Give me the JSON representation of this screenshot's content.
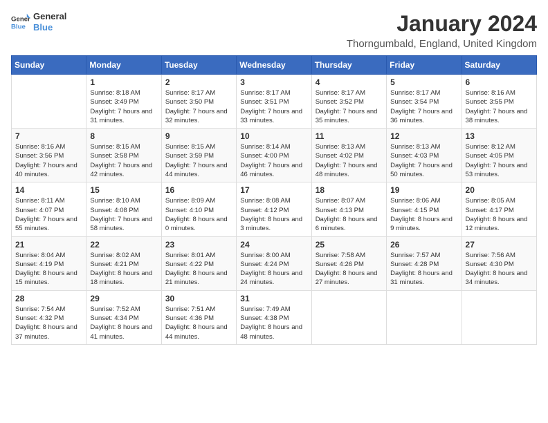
{
  "logo": {
    "line1": "General",
    "line2": "Blue"
  },
  "title": "January 2024",
  "location": "Thorngumbald, England, United Kingdom",
  "days_of_week": [
    "Sunday",
    "Monday",
    "Tuesday",
    "Wednesday",
    "Thursday",
    "Friday",
    "Saturday"
  ],
  "weeks": [
    [
      {
        "day": "",
        "sunrise": "",
        "sunset": "",
        "daylight": ""
      },
      {
        "day": "1",
        "sunrise": "Sunrise: 8:18 AM",
        "sunset": "Sunset: 3:49 PM",
        "daylight": "Daylight: 7 hours and 31 minutes."
      },
      {
        "day": "2",
        "sunrise": "Sunrise: 8:17 AM",
        "sunset": "Sunset: 3:50 PM",
        "daylight": "Daylight: 7 hours and 32 minutes."
      },
      {
        "day": "3",
        "sunrise": "Sunrise: 8:17 AM",
        "sunset": "Sunset: 3:51 PM",
        "daylight": "Daylight: 7 hours and 33 minutes."
      },
      {
        "day": "4",
        "sunrise": "Sunrise: 8:17 AM",
        "sunset": "Sunset: 3:52 PM",
        "daylight": "Daylight: 7 hours and 35 minutes."
      },
      {
        "day": "5",
        "sunrise": "Sunrise: 8:17 AM",
        "sunset": "Sunset: 3:54 PM",
        "daylight": "Daylight: 7 hours and 36 minutes."
      },
      {
        "day": "6",
        "sunrise": "Sunrise: 8:16 AM",
        "sunset": "Sunset: 3:55 PM",
        "daylight": "Daylight: 7 hours and 38 minutes."
      }
    ],
    [
      {
        "day": "7",
        "sunrise": "Sunrise: 8:16 AM",
        "sunset": "Sunset: 3:56 PM",
        "daylight": "Daylight: 7 hours and 40 minutes."
      },
      {
        "day": "8",
        "sunrise": "Sunrise: 8:15 AM",
        "sunset": "Sunset: 3:58 PM",
        "daylight": "Daylight: 7 hours and 42 minutes."
      },
      {
        "day": "9",
        "sunrise": "Sunrise: 8:15 AM",
        "sunset": "Sunset: 3:59 PM",
        "daylight": "Daylight: 7 hours and 44 minutes."
      },
      {
        "day": "10",
        "sunrise": "Sunrise: 8:14 AM",
        "sunset": "Sunset: 4:00 PM",
        "daylight": "Daylight: 7 hours and 46 minutes."
      },
      {
        "day": "11",
        "sunrise": "Sunrise: 8:13 AM",
        "sunset": "Sunset: 4:02 PM",
        "daylight": "Daylight: 7 hours and 48 minutes."
      },
      {
        "day": "12",
        "sunrise": "Sunrise: 8:13 AM",
        "sunset": "Sunset: 4:03 PM",
        "daylight": "Daylight: 7 hours and 50 minutes."
      },
      {
        "day": "13",
        "sunrise": "Sunrise: 8:12 AM",
        "sunset": "Sunset: 4:05 PM",
        "daylight": "Daylight: 7 hours and 53 minutes."
      }
    ],
    [
      {
        "day": "14",
        "sunrise": "Sunrise: 8:11 AM",
        "sunset": "Sunset: 4:07 PM",
        "daylight": "Daylight: 7 hours and 55 minutes."
      },
      {
        "day": "15",
        "sunrise": "Sunrise: 8:10 AM",
        "sunset": "Sunset: 4:08 PM",
        "daylight": "Daylight: 7 hours and 58 minutes."
      },
      {
        "day": "16",
        "sunrise": "Sunrise: 8:09 AM",
        "sunset": "Sunset: 4:10 PM",
        "daylight": "Daylight: 8 hours and 0 minutes."
      },
      {
        "day": "17",
        "sunrise": "Sunrise: 8:08 AM",
        "sunset": "Sunset: 4:12 PM",
        "daylight": "Daylight: 8 hours and 3 minutes."
      },
      {
        "day": "18",
        "sunrise": "Sunrise: 8:07 AM",
        "sunset": "Sunset: 4:13 PM",
        "daylight": "Daylight: 8 hours and 6 minutes."
      },
      {
        "day": "19",
        "sunrise": "Sunrise: 8:06 AM",
        "sunset": "Sunset: 4:15 PM",
        "daylight": "Daylight: 8 hours and 9 minutes."
      },
      {
        "day": "20",
        "sunrise": "Sunrise: 8:05 AM",
        "sunset": "Sunset: 4:17 PM",
        "daylight": "Daylight: 8 hours and 12 minutes."
      }
    ],
    [
      {
        "day": "21",
        "sunrise": "Sunrise: 8:04 AM",
        "sunset": "Sunset: 4:19 PM",
        "daylight": "Daylight: 8 hours and 15 minutes."
      },
      {
        "day": "22",
        "sunrise": "Sunrise: 8:02 AM",
        "sunset": "Sunset: 4:21 PM",
        "daylight": "Daylight: 8 hours and 18 minutes."
      },
      {
        "day": "23",
        "sunrise": "Sunrise: 8:01 AM",
        "sunset": "Sunset: 4:22 PM",
        "daylight": "Daylight: 8 hours and 21 minutes."
      },
      {
        "day": "24",
        "sunrise": "Sunrise: 8:00 AM",
        "sunset": "Sunset: 4:24 PM",
        "daylight": "Daylight: 8 hours and 24 minutes."
      },
      {
        "day": "25",
        "sunrise": "Sunrise: 7:58 AM",
        "sunset": "Sunset: 4:26 PM",
        "daylight": "Daylight: 8 hours and 27 minutes."
      },
      {
        "day": "26",
        "sunrise": "Sunrise: 7:57 AM",
        "sunset": "Sunset: 4:28 PM",
        "daylight": "Daylight: 8 hours and 31 minutes."
      },
      {
        "day": "27",
        "sunrise": "Sunrise: 7:56 AM",
        "sunset": "Sunset: 4:30 PM",
        "daylight": "Daylight: 8 hours and 34 minutes."
      }
    ],
    [
      {
        "day": "28",
        "sunrise": "Sunrise: 7:54 AM",
        "sunset": "Sunset: 4:32 PM",
        "daylight": "Daylight: 8 hours and 37 minutes."
      },
      {
        "day": "29",
        "sunrise": "Sunrise: 7:52 AM",
        "sunset": "Sunset: 4:34 PM",
        "daylight": "Daylight: 8 hours and 41 minutes."
      },
      {
        "day": "30",
        "sunrise": "Sunrise: 7:51 AM",
        "sunset": "Sunset: 4:36 PM",
        "daylight": "Daylight: 8 hours and 44 minutes."
      },
      {
        "day": "31",
        "sunrise": "Sunrise: 7:49 AM",
        "sunset": "Sunset: 4:38 PM",
        "daylight": "Daylight: 8 hours and 48 minutes."
      },
      {
        "day": "",
        "sunrise": "",
        "sunset": "",
        "daylight": ""
      },
      {
        "day": "",
        "sunrise": "",
        "sunset": "",
        "daylight": ""
      },
      {
        "day": "",
        "sunrise": "",
        "sunset": "",
        "daylight": ""
      }
    ]
  ]
}
